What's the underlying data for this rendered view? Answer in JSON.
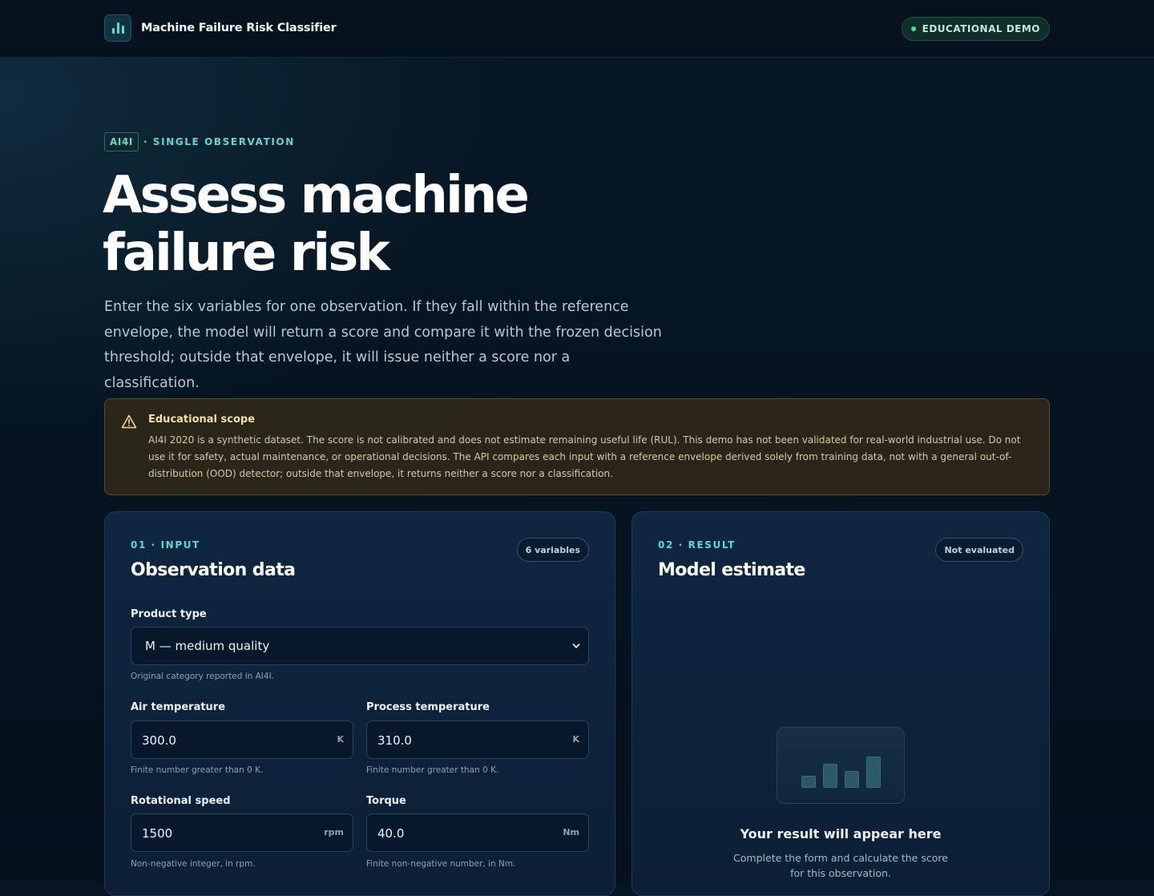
{
  "header": {
    "app_title": "Machine Failure Risk Classifier",
    "badge": "EDUCATIONAL DEMO",
    "logo_icon": "bar-chart-icon"
  },
  "hero": {
    "tag": "AI4I",
    "eyebrow": "· SINGLE OBSERVATION",
    "title": "Assess machine failure risk",
    "lead": "Enter the six variables for one observation. If they fall within the reference envelope, the model will return a score and compare it with the frozen decision threshold; outside that envelope, it will issue neither a score nor a classification."
  },
  "scope": {
    "icon": "warning-triangle-icon",
    "title": "Educational scope",
    "text": "AI4I 2020 is a synthetic dataset. The score is not calibrated and does not estimate remaining useful life (RUL). This demo has not been validated for real-world industrial use. Do not use it for safety, actual maintenance, or operational decisions. The API compares each input with a reference envelope derived solely from training data, not with a general out-of-distribution (OOD) detector; outside that envelope, it returns neither a score nor a classification."
  },
  "input_card": {
    "eyebrow": "01 · INPUT",
    "title": "Observation data",
    "pill": "6 variables",
    "product_type": {
      "label": "Product type",
      "value": "M — medium quality",
      "help": "Original category reported in AI4I."
    },
    "air_temperature": {
      "label": "Air temperature",
      "value": "300.0",
      "unit": "K",
      "help": "Finite number greater than 0 K."
    },
    "process_temperature": {
      "label": "Process temperature",
      "value": "310.0",
      "unit": "K",
      "help": "Finite number greater than 0 K."
    },
    "rotational_speed": {
      "label": "Rotational speed",
      "value": "1500",
      "unit": "rpm",
      "help": "Non-negative integer, in rpm."
    },
    "torque": {
      "label": "Torque",
      "value": "40.0",
      "unit": "Nm",
      "help": "Finite non-negative number, in Nm."
    }
  },
  "result_card": {
    "eyebrow": "02 · RESULT",
    "title": "Model estimate",
    "pill": "Not evaluated",
    "placeholder_icon": "bar-chart-placeholder-icon",
    "empty_title": "Your result will appear here",
    "empty_text": "Complete the form and calculate the score for this observation."
  },
  "colors": {
    "accent": "#63d8c8",
    "background": "#061423",
    "warning_text": "#f6dfa2",
    "status_dot": "#4ade80"
  }
}
